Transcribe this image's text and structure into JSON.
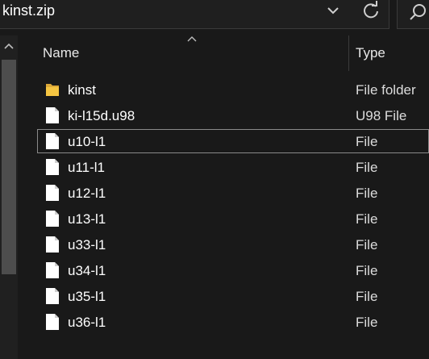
{
  "address": {
    "path": "kinst.zip",
    "dropdown_icon": "chevron-down-icon",
    "refresh_icon": "refresh-icon"
  },
  "search": {
    "icon": "search-icon"
  },
  "columns": {
    "name": "Name",
    "type": "Type"
  },
  "files": [
    {
      "name": "kinst",
      "type": "File folder",
      "icon": "folder-icon"
    },
    {
      "name": "ki-l15d.u98",
      "type": "U98 File",
      "icon": "file-icon"
    },
    {
      "name": "u10-l1",
      "type": "File",
      "icon": "file-icon",
      "focused": true
    },
    {
      "name": "u11-l1",
      "type": "File",
      "icon": "file-icon"
    },
    {
      "name": "u12-l1",
      "type": "File",
      "icon": "file-icon"
    },
    {
      "name": "u13-l1",
      "type": "File",
      "icon": "file-icon"
    },
    {
      "name": "u33-l1",
      "type": "File",
      "icon": "file-icon"
    },
    {
      "name": "u34-l1",
      "type": "File",
      "icon": "file-icon"
    },
    {
      "name": "u35-l1",
      "type": "File",
      "icon": "file-icon"
    },
    {
      "name": "u36-l1",
      "type": "File",
      "icon": "file-icon"
    }
  ],
  "colors": {
    "background": "#191919",
    "folder": "#f5c542",
    "file": "#ffffff",
    "focus_border": "#8a8a8a"
  }
}
